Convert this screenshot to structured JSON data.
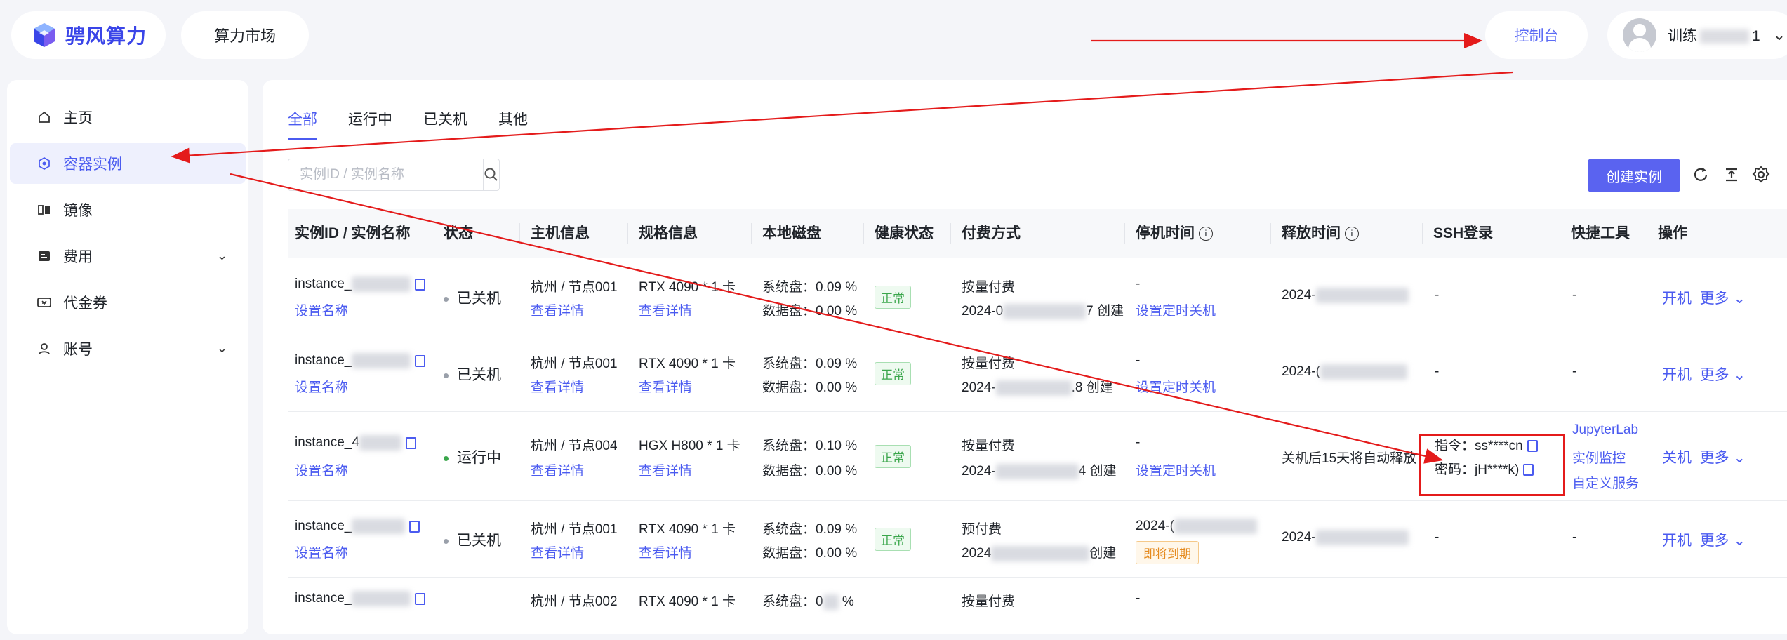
{
  "brand": {
    "logo_text": "骋风算力"
  },
  "topbar": {
    "market": "算力市场",
    "console": "控制台",
    "user_prefix": "训练",
    "user_suffix": "1"
  },
  "sidebar": {
    "items": [
      {
        "label": "主页",
        "icon": "home-icon"
      },
      {
        "label": "容器实例",
        "icon": "container-icon",
        "active": true
      },
      {
        "label": "镜像",
        "icon": "image-icon"
      },
      {
        "label": "费用",
        "icon": "billing-icon",
        "expandable": true
      },
      {
        "label": "代金券",
        "icon": "voucher-icon"
      },
      {
        "label": "账号",
        "icon": "user-icon",
        "expandable": true
      }
    ]
  },
  "tabs": [
    "全部",
    "运行中",
    "已关机",
    "其他"
  ],
  "search": {
    "placeholder": "实例ID / 实例名称"
  },
  "actions": {
    "create": "创建实例"
  },
  "table": {
    "headers": [
      "实例ID / 实例名称",
      "状态",
      "主机信息",
      "规格信息",
      "本地磁盘",
      "健康状态",
      "付费方式",
      "停机时间",
      "释放时间",
      "SSH登录",
      "快捷工具",
      "操作"
    ],
    "rows": [
      {
        "id": "instance_",
        "name_link": "设置名称",
        "status": "已关机",
        "host": "杭州 / 节点001",
        "host_link": "查看详情",
        "spec": "RTX 4090 * 1 卡",
        "spec_link": "查看详情",
        "disk_sys": "系统盘：0.09 %",
        "disk_data": "数据盘：0.00 %",
        "health": "正常",
        "pay_type": "按量付费",
        "pay_prefix": "2024-0",
        "pay_suffix": "7 创建",
        "stop_time": "-",
        "stop_link": "设置定时关机",
        "release": "2024-",
        "ssh": "-",
        "tools": "-",
        "op_primary": "开机",
        "op_more": "更多"
      },
      {
        "id": "instance_",
        "name_link": "设置名称",
        "status": "已关机",
        "host": "杭州 / 节点001",
        "host_link": "查看详情",
        "spec": "RTX 4090 * 1 卡",
        "spec_link": "查看详情",
        "disk_sys": "系统盘：0.09 %",
        "disk_data": "数据盘：0.00 %",
        "health": "正常",
        "pay_type": "按量付费",
        "pay_prefix": "2024-",
        "pay_suffix": ".8 创建",
        "stop_time": "-",
        "stop_link": "设置定时关机",
        "release": "2024-(",
        "ssh": "-",
        "tools": "-",
        "op_primary": "开机",
        "op_more": "更多"
      },
      {
        "id": "instance_4",
        "name_link": "设置名称",
        "status": "运行中",
        "host": "杭州 / 节点004",
        "host_link": "查看详情",
        "spec": "HGX H800 * 1 卡",
        "spec_link": "查看详情",
        "disk_sys": "系统盘：0.10 %",
        "disk_data": "数据盘：0.00 %",
        "health": "正常",
        "pay_type": "按量付费",
        "pay_prefix": "2024-",
        "pay_suffix": "4 创建",
        "stop_time": "-",
        "stop_link": "设置定时关机",
        "release": "关机后15天将自动释放",
        "ssh_cmd": "指令：ss****cn",
        "ssh_pwd": "密码：jH****k)",
        "tools_list": [
          "JupyterLab",
          "实例监控",
          "自定义服务"
        ],
        "op_primary": "关机",
        "op_more": "更多"
      },
      {
        "id": "instance_",
        "name_link": "设置名称",
        "status": "已关机",
        "host": "杭州 / 节点001",
        "host_link": "查看详情",
        "spec": "RTX 4090 * 1 卡",
        "spec_link": "查看详情",
        "disk_sys": "系统盘：0.09 %",
        "disk_data": "数据盘：0.00 %",
        "health": "正常",
        "pay_type": "预付费",
        "pay_prefix": "2024",
        "pay_suffix": "创建",
        "stop_time": "2024-(",
        "stop_badge": "即将到期",
        "release": "2024-",
        "ssh": "-",
        "tools": "-",
        "op_primary": "开机",
        "op_more": "更多"
      },
      {
        "id": "instance_",
        "host": "杭州 / 节点002",
        "spec": "RTX 4090 * 1 卡",
        "disk_sys_prefix": "系统盘：0",
        "disk_sys_suffix": "%",
        "pay_type": "按量付费",
        "stop_time": "-"
      }
    ]
  },
  "colors": {
    "accent": "#4b5bf0",
    "button": "#5a63f0",
    "running_dot": "#3aa64b",
    "stopped_dot": "#9aa0aa",
    "annotation": "#e41b1b"
  }
}
